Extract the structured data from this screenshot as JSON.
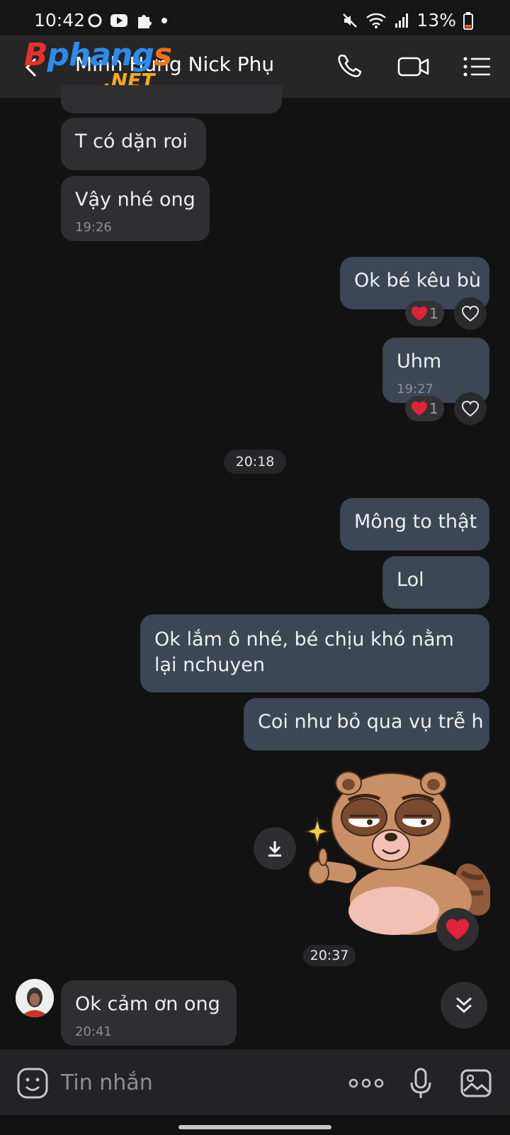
{
  "status_bar": {
    "time": "10:42",
    "battery": "13%",
    "icons": [
      "record-icon",
      "youtube-icon",
      "puzzle-icon",
      "dot-icon",
      "mute-icon",
      "wifi-icon",
      "signal-icon",
      "battery-icon"
    ]
  },
  "header": {
    "title": "Minh Hưng Nick Phụ",
    "watermark": {
      "brand": "Bphangs",
      "brand_parts": [
        "B",
        "phang",
        "s"
      ],
      "domain": ".NET"
    },
    "actions": [
      "phone-icon",
      "video-icon",
      "menu-list-icon"
    ]
  },
  "messages": [
    {
      "id": "m1",
      "side": "in",
      "text": "T có dặn roi"
    },
    {
      "id": "m2",
      "side": "in",
      "text": "Vậy nhé ong",
      "time": "19:26"
    },
    {
      "id": "m3",
      "side": "out",
      "text": "Ok bé kêu bù",
      "reaction_count": "1"
    },
    {
      "id": "m4",
      "side": "out",
      "text": "Uhm",
      "time": "19:27",
      "reaction_count": "1"
    },
    {
      "id": "m5",
      "side": "out",
      "text": "Mông to thật"
    },
    {
      "id": "m6",
      "side": "out",
      "text": "Lol"
    },
    {
      "id": "m7",
      "side": "out",
      "text": "Ok lắm ô nhé, bé chịu khó nằm lại nchuyen"
    },
    {
      "id": "m8",
      "side": "out",
      "text": "Coi như bỏ qua vụ trễ h"
    },
    {
      "id": "m9",
      "side": "in",
      "text": "Ok cảm ơn ong",
      "time": "20:41"
    }
  ],
  "date_chips": {
    "first": "20:18",
    "second": "20:37"
  },
  "sticker": {
    "name": "raccoon-thumbs-up-sticker"
  },
  "composer": {
    "placeholder": "Tin nhắn"
  },
  "colors": {
    "background": "#121212",
    "bubble_in": "#2f2f31",
    "bubble_out": "#3c4654",
    "header": "#262626",
    "heart": "#e0223a"
  }
}
